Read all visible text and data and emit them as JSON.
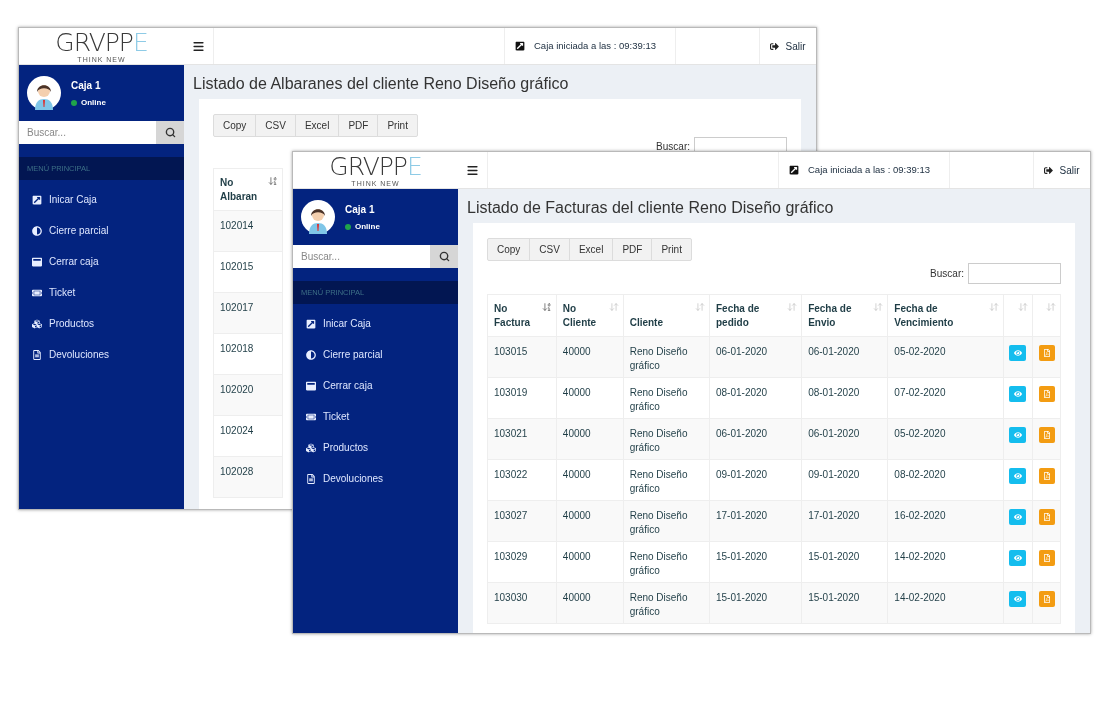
{
  "windows": [
    {
      "logo": {
        "wordmark": "GRVPPE",
        "tagline": "THINK NEW"
      },
      "session": "Caja iniciada a las : 09:39:13",
      "logout": "Salir",
      "user": {
        "name": "Caja 1",
        "status": "Online"
      },
      "sidebar_search": {
        "placeholder": "Buscar..."
      },
      "menu_header": "MENÚ PRINCIPAL",
      "menu": [
        {
          "label": "Inicar Caja"
        },
        {
          "label": "Cierre parcial"
        },
        {
          "label": "Cerrar caja"
        },
        {
          "label": "Ticket"
        },
        {
          "label": "Productos"
        },
        {
          "label": "Devoluciones"
        }
      ],
      "title": "Listado de Albaranes del cliente Reno Diseño gráfico",
      "export_buttons": [
        "Copy",
        "CSV",
        "Excel",
        "PDF",
        "Print"
      ],
      "search_label": "Buscar:",
      "table": {
        "columns": [
          {
            "label": "No Albaran",
            "sorted": true
          }
        ],
        "rows": [
          [
            "102014"
          ],
          [
            "102015"
          ],
          [
            "102017"
          ],
          [
            "102018"
          ],
          [
            "102020"
          ],
          [
            "102024"
          ],
          [
            "102028"
          ]
        ]
      }
    },
    {
      "logo": {
        "wordmark": "GRVPPE",
        "tagline": "THINK NEW"
      },
      "session": "Caja iniciada a las : 09:39:13",
      "logout": "Salir",
      "user": {
        "name": "Caja 1",
        "status": "Online"
      },
      "sidebar_search": {
        "placeholder": "Buscar..."
      },
      "menu_header": "MENÚ PRINCIPAL",
      "menu": [
        {
          "label": "Inicar Caja"
        },
        {
          "label": "Cierre parcial"
        },
        {
          "label": "Cerrar caja"
        },
        {
          "label": "Ticket"
        },
        {
          "label": "Productos"
        },
        {
          "label": "Devoluciones"
        }
      ],
      "title": "Listado de Facturas del cliente Reno Diseño gráfico",
      "export_buttons": [
        "Copy",
        "CSV",
        "Excel",
        "PDF",
        "Print"
      ],
      "search_label": "Buscar:",
      "table": {
        "columns": [
          {
            "label": "No Factura",
            "sorted": true
          },
          {
            "label": "No Cliente",
            "sorted": false
          },
          {
            "label": "Cliente",
            "sorted": false
          },
          {
            "label": "Fecha de pedido",
            "sorted": false
          },
          {
            "label": "Fecha de Envio",
            "sorted": false
          },
          {
            "label": "Fecha de Vencimiento",
            "sorted": false
          },
          {
            "sorted": false
          },
          {
            "sorted": false
          }
        ],
        "rows": [
          [
            "103015",
            "40000",
            "Reno Diseño gráfico",
            "06-01-2020",
            "06-01-2020",
            "05-02-2020"
          ],
          [
            "103019",
            "40000",
            "Reno Diseño gráfico",
            "08-01-2020",
            "08-01-2020",
            "07-02-2020"
          ],
          [
            "103021",
            "40000",
            "Reno Diseño gráfico",
            "06-01-2020",
            "06-01-2020",
            "05-02-2020"
          ],
          [
            "103022",
            "40000",
            "Reno Diseño gráfico",
            "09-01-2020",
            "09-01-2020",
            "08-02-2020"
          ],
          [
            "103027",
            "40000",
            "Reno Diseño gráfico",
            "17-01-2020",
            "17-01-2020",
            "16-02-2020"
          ],
          [
            "103029",
            "40000",
            "Reno Diseño gráfico",
            "15-01-2020",
            "15-01-2020",
            "14-02-2020"
          ],
          [
            "103030",
            "40000",
            "Reno Diseño gráfico",
            "15-01-2020",
            "15-01-2020",
            "14-02-2020"
          ]
        ]
      }
    }
  ]
}
